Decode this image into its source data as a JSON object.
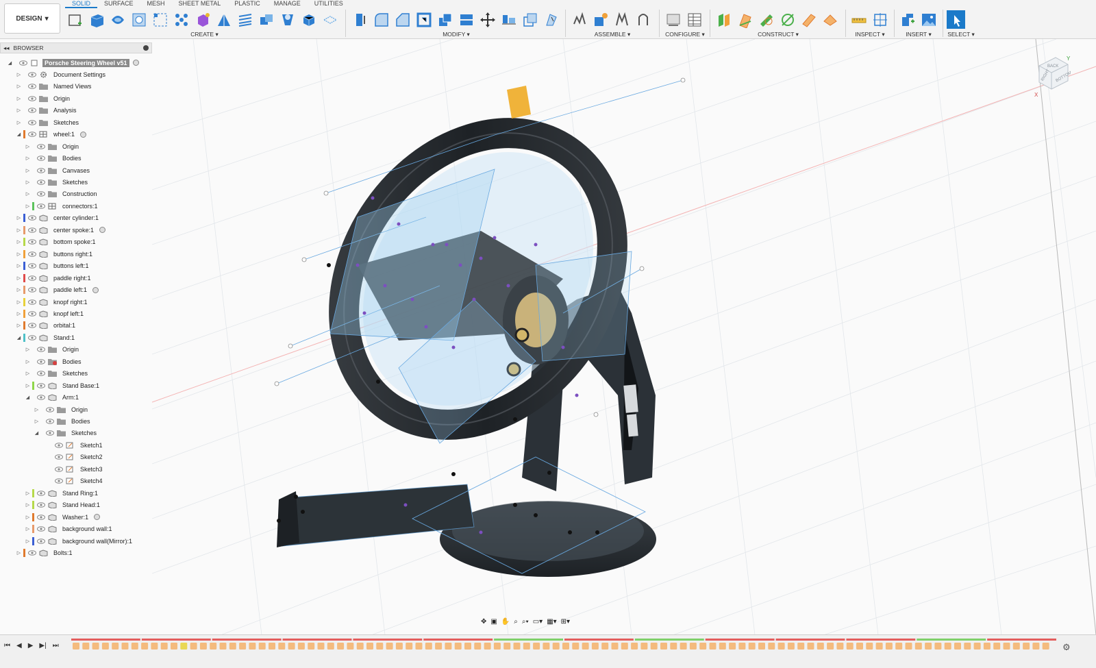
{
  "toolbar": {
    "workspace_label": "DESIGN",
    "tabs": [
      {
        "label": "SOLID",
        "active": true
      },
      {
        "label": "SURFACE",
        "active": false
      },
      {
        "label": "MESH",
        "active": false
      },
      {
        "label": "SHEET METAL",
        "active": false
      },
      {
        "label": "PLASTIC",
        "active": false
      },
      {
        "label": "MANAGE",
        "active": false
      },
      {
        "label": "UTILITIES",
        "active": false
      }
    ],
    "groups": {
      "create": "CREATE",
      "modify": "MODIFY",
      "assemble": "ASSEMBLE",
      "configure": "CONFIGURE",
      "construct": "CONSTRUCT",
      "inspect": "INSPECT",
      "insert": "INSERT",
      "select": "SELECT"
    },
    "accent": "#1b7ac9"
  },
  "browser": {
    "title": "BROWSER",
    "items": [
      {
        "label": "Porsche Steering Wheel v51",
        "depth": 0,
        "tri": "open",
        "icon": "document",
        "header": true,
        "radio": true,
        "color": ""
      },
      {
        "label": "Document Settings",
        "depth": 1,
        "tri": "closed",
        "icon": "gear",
        "color": ""
      },
      {
        "label": "Named Views",
        "depth": 1,
        "tri": "closed",
        "icon": "folder",
        "color": ""
      },
      {
        "label": "Origin",
        "depth": 1,
        "tri": "closed",
        "icon": "folder",
        "eye": true,
        "color": ""
      },
      {
        "label": "Analysis",
        "depth": 1,
        "tri": "closed",
        "icon": "folder",
        "eye": true,
        "color": ""
      },
      {
        "label": "Sketches",
        "depth": 1,
        "tri": "closed",
        "icon": "folder",
        "eye": true,
        "color": ""
      },
      {
        "label": "wheel:1",
        "depth": 1,
        "tri": "open",
        "icon": "component",
        "eye": true,
        "radio": true,
        "color": "#e07a2e"
      },
      {
        "label": "Origin",
        "depth": 2,
        "tri": "closed",
        "icon": "folder",
        "eye": true,
        "color": ""
      },
      {
        "label": "Bodies",
        "depth": 2,
        "tri": "closed",
        "icon": "folder",
        "eye": true,
        "color": ""
      },
      {
        "label": "Canvases",
        "depth": 2,
        "tri": "closed",
        "icon": "folder",
        "eye": true,
        "color": ""
      },
      {
        "label": "Sketches",
        "depth": 2,
        "tri": "closed",
        "icon": "folder",
        "eye": true,
        "color": ""
      },
      {
        "label": "Construction",
        "depth": 2,
        "tri": "closed",
        "icon": "folder",
        "eye": true,
        "color": ""
      },
      {
        "label": "connectors:1",
        "depth": 2,
        "tri": "closed",
        "icon": "component",
        "eye": true,
        "color": "#5cc35c"
      },
      {
        "label": "center cylinder:1",
        "depth": 1,
        "tri": "closed",
        "icon": "body",
        "eye": true,
        "color": "#3b5fd4"
      },
      {
        "label": "center spoke:1",
        "depth": 1,
        "tri": "closed",
        "icon": "body",
        "eye": true,
        "radio": true,
        "color": "#e79a6b"
      },
      {
        "label": "bottom spoke:1",
        "depth": 1,
        "tri": "closed",
        "icon": "body",
        "eye": true,
        "color": "#b6d94a"
      },
      {
        "label": "buttons right:1",
        "depth": 1,
        "tri": "closed",
        "icon": "body",
        "eye": true,
        "color": "#f0a13a"
      },
      {
        "label": "buttons left:1",
        "depth": 1,
        "tri": "closed",
        "icon": "body",
        "eye": true,
        "color": "#3b5fd4"
      },
      {
        "label": "paddle right:1",
        "depth": 1,
        "tri": "closed",
        "icon": "body",
        "eye": true,
        "color": "#e04a4a"
      },
      {
        "label": "paddle left:1",
        "depth": 1,
        "tri": "closed",
        "icon": "body",
        "eye": true,
        "radio": true,
        "color": "#e79a6b"
      },
      {
        "label": "knopf right:1",
        "depth": 1,
        "tri": "closed",
        "icon": "body",
        "eye": true,
        "color": "#e8d13a"
      },
      {
        "label": "knopf left:1",
        "depth": 1,
        "tri": "closed",
        "icon": "body",
        "eye": true,
        "color": "#f0a13a"
      },
      {
        "label": "orbital:1",
        "depth": 1,
        "tri": "closed",
        "icon": "body",
        "eye": true,
        "color": "#e07a2e"
      },
      {
        "label": "Stand:1",
        "depth": 1,
        "tri": "open",
        "icon": "body",
        "eye": true,
        "color": "#4fc1c8"
      },
      {
        "label": "Origin",
        "depth": 2,
        "tri": "closed",
        "icon": "folder",
        "eye": true,
        "color": ""
      },
      {
        "label": "Bodies",
        "depth": 2,
        "tri": "closed",
        "icon": "bodies-error",
        "eye": true,
        "color": ""
      },
      {
        "label": "Sketches",
        "depth": 2,
        "tri": "closed",
        "icon": "folder",
        "eye": true,
        "color": ""
      },
      {
        "label": "Stand Base:1",
        "depth": 2,
        "tri": "closed",
        "icon": "body",
        "eye": true,
        "color": "#8fd64a"
      },
      {
        "label": "Arm:1",
        "depth": 2,
        "tri": "open",
        "icon": "body",
        "eye": true,
        "color": ""
      },
      {
        "label": "Origin",
        "depth": 3,
        "tri": "closed",
        "icon": "folder",
        "eye": true,
        "color": ""
      },
      {
        "label": "Bodies",
        "depth": 3,
        "tri": "closed",
        "icon": "folder",
        "eye": true,
        "color": ""
      },
      {
        "label": "Sketches",
        "depth": 3,
        "tri": "open",
        "icon": "folder",
        "eye": true,
        "color": ""
      },
      {
        "label": "Sketch1",
        "depth": 4,
        "tri": "none",
        "icon": "sketch",
        "eye": true,
        "color": ""
      },
      {
        "label": "Sketch2",
        "depth": 4,
        "tri": "none",
        "icon": "sketch",
        "eye": true,
        "color": ""
      },
      {
        "label": "Sketch3",
        "depth": 4,
        "tri": "none",
        "icon": "sketch",
        "eye": true,
        "color": ""
      },
      {
        "label": "Sketch4",
        "depth": 4,
        "tri": "none",
        "icon": "sketch",
        "eye": true,
        "color": ""
      },
      {
        "label": "Stand Ring:1",
        "depth": 2,
        "tri": "closed",
        "icon": "body",
        "eye": true,
        "color": "#b6d94a"
      },
      {
        "label": "Stand Head:1",
        "depth": 2,
        "tri": "closed",
        "icon": "body",
        "eye": true,
        "color": "#b6d94a"
      },
      {
        "label": "Washer:1",
        "depth": 2,
        "tri": "closed",
        "icon": "body",
        "eye": true,
        "radio": true,
        "color": "#e07a2e"
      },
      {
        "label": "background wall:1",
        "depth": 2,
        "tri": "closed",
        "icon": "body",
        "eye": true,
        "color": "#e79a6b"
      },
      {
        "label": "background wall(Mirror):1",
        "depth": 2,
        "tri": "closed",
        "icon": "body",
        "eye": true,
        "color": "#3b5fd4"
      },
      {
        "label": "Bolts:1",
        "depth": 1,
        "tri": "closed",
        "icon": "body",
        "eye": true,
        "color": "#e07a2e"
      }
    ]
  },
  "viewcube": {
    "faces": [
      "BACK",
      "RIGHT",
      "BOTTOM"
    ],
    "axis_x": "X",
    "axis_y": "Y"
  },
  "timeline": {
    "marker_color": "#e8d43a"
  }
}
